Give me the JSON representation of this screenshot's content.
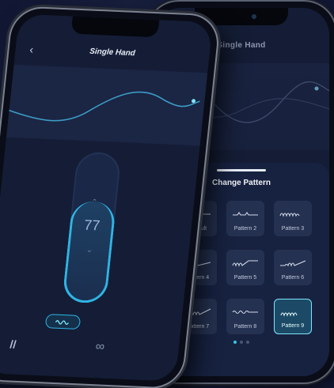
{
  "front_screen": {
    "title": "Single Hand",
    "back_icon": "chevron-left-icon",
    "intensity_value": "77",
    "up_icon": "chevron-up-icon",
    "down_icon": "chevron-down-icon",
    "current_pattern_icon": "wave-pattern-icon",
    "nav_left_icon": "pause-icon",
    "nav_left_glyph": "//",
    "nav_right_icon": "infinity-icon",
    "nav_right_glyph": "∞"
  },
  "back_screen": {
    "title": "Single Hand",
    "sheet_title": "Change Pattern",
    "patterns": [
      {
        "label": "Default"
      },
      {
        "label": "Pattern 2"
      },
      {
        "label": "Pattern 3"
      },
      {
        "label": "Pattern 4"
      },
      {
        "label": "Pattern 5"
      },
      {
        "label": "Pattern 6"
      },
      {
        "label": "Pattern 7"
      },
      {
        "label": "Pattern 8"
      },
      {
        "label": "Pattern 9"
      }
    ],
    "selected_pattern": "Pattern 9",
    "page_dots": 3,
    "active_dot": 1
  },
  "colors": {
    "accent": "#2fb4e4",
    "background": "#141a36",
    "surface": "#172240",
    "tile": "#243150"
  }
}
